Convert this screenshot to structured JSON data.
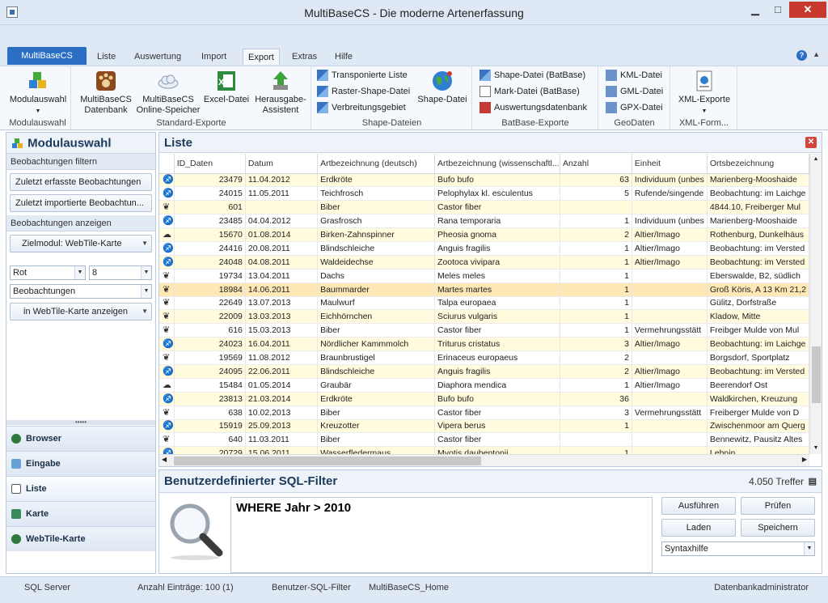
{
  "window": {
    "title": "MultiBaseCS - Die moderne Artenerfassung",
    "minimize": "▁",
    "maximize": "□",
    "close": "✕"
  },
  "ribbon": {
    "app_tab": "MultiBaseCS",
    "tabs": [
      "Liste",
      "Auswertung",
      "Import",
      "Export",
      "Extras",
      "Hilfe"
    ],
    "active_tab": "Export",
    "groups": {
      "modulauswahl": {
        "label": "Modulauswahl",
        "button": "Modulauswahl"
      },
      "standard": {
        "label": "Standard-Exporte",
        "b1a": "MultiBaseCS",
        "b1b": "Datenbank",
        "b2a": "MultiBaseCS",
        "b2b": "Online-Speicher",
        "b3": "Excel-Datei",
        "b4a": "Herausgabe-",
        "b4b": "Assistent"
      },
      "shape": {
        "label": "Shape-Dateien",
        "s1": "Transponierte Liste",
        "s2": "Raster-Shape-Datei",
        "s3": "Verbreitungsgebiet",
        "big": "Shape-Datei"
      },
      "batbase": {
        "label": "BatBase-Exporte",
        "s1": "Shape-Datei (BatBase)",
        "s2": "Mark-Datei (BatBase)",
        "s3": "Auswertungsdatenbank"
      },
      "geodaten": {
        "label": "GeoDaten",
        "s1": "KML-Datei",
        "s2": "GML-Datei",
        "s3": "GPX-Datei"
      },
      "xml": {
        "label": "XML-Form...",
        "big": "XML-Exporte"
      }
    }
  },
  "left": {
    "title": "Modulauswahl",
    "filter_section": "Beobachtungen filtern",
    "btn_recent_captured": "Zuletzt erfasste Beobachtungen",
    "btn_recent_imported": "Zuletzt  importierte Beobachtun...",
    "show_section": "Beobachtungen anzeigen",
    "target_module": "Zielmodul: WebTile-Karte",
    "color_value": "Rot",
    "size_value": "8",
    "type_value": "Beobachtungen",
    "show_in": "in WebTile-Karte anzeigen",
    "nav": [
      "Browser",
      "Eingabe",
      "Liste",
      "Karte",
      "WebTile-Karte"
    ]
  },
  "list": {
    "title": "Liste",
    "columns": [
      "ID_Daten",
      "Datum",
      "Artbezeichnung (deutsch)",
      "Artbezeichnung  (wissenschaftl...",
      "Anzahl",
      "Einheit",
      "Ortsbezeichnung"
    ],
    "rows": [
      {
        "icon": "frog",
        "id": "23479",
        "date": "11.04.2012",
        "de": "Erdkröte",
        "sci": "Bufo bufo",
        "n": "63",
        "unit": "Individuum (unbes",
        "place": "Marienberg-Mooshaide"
      },
      {
        "icon": "frog",
        "id": "24015",
        "date": "11.05.2011",
        "de": "Teichfrosch",
        "sci": "Pelophylax kl. esculentus",
        "n": "5",
        "unit": "Rufende/singende",
        "place": "Beobachtung: im Laichge"
      },
      {
        "icon": "paw",
        "id": "601",
        "date": "",
        "de": "Biber",
        "sci": "Castor fiber",
        "n": "",
        "unit": "",
        "place": "4844.10, Freiberger Mul"
      },
      {
        "icon": "frog",
        "id": "23485",
        "date": "04.04.2012",
        "de": "Grasfrosch",
        "sci": "Rana temporaria",
        "n": "1",
        "unit": "Individuum (unbes",
        "place": "Marienberg-Mooshaide"
      },
      {
        "icon": "moth",
        "id": "15670",
        "date": "01.08.2014",
        "de": "Birken-Zahnspinner",
        "sci": "Pheosia gnoma",
        "n": "2",
        "unit": "Altier/Imago",
        "place": "Rothenburg, Dunkelhäus"
      },
      {
        "icon": "frog",
        "id": "24416",
        "date": "20.08.2011",
        "de": "Blindschleiche",
        "sci": "Anguis fragilis",
        "n": "1",
        "unit": "Altier/Imago",
        "place": "Beobachtung: im Versted"
      },
      {
        "icon": "frog",
        "id": "24048",
        "date": "04.08.2011",
        "de": "Waldeidechse",
        "sci": "Zootoca vivipara",
        "n": "1",
        "unit": "Altier/Imago",
        "place": "Beobachtung: im Versted"
      },
      {
        "icon": "paw",
        "id": "19734",
        "date": "13.04.2011",
        "de": "Dachs",
        "sci": "Meles meles",
        "n": "1",
        "unit": "",
        "place": "Eberswalde, B2, südlich"
      },
      {
        "icon": "paw",
        "id": "18984",
        "date": "14.06.2011",
        "de": "Baummarder",
        "sci": "Martes martes",
        "n": "1",
        "unit": "",
        "place": "Groß Köris, A 13 Km 21,2"
      },
      {
        "icon": "paw",
        "id": "22649",
        "date": "13.07.2013",
        "de": "Maulwurf",
        "sci": "Talpa europaea",
        "n": "1",
        "unit": "",
        "place": "Gülitz, Dorfstraße"
      },
      {
        "icon": "paw",
        "id": "22009",
        "date": "13.03.2013",
        "de": "Eichhörnchen",
        "sci": "Sciurus vulgaris",
        "n": "1",
        "unit": "",
        "place": "Kladow, Mitte"
      },
      {
        "icon": "paw",
        "id": "616",
        "date": "15.03.2013",
        "de": "Biber",
        "sci": "Castor fiber",
        "n": "1",
        "unit": "Vermehrungsstätt",
        "place": "Freibger Mulde von Mul"
      },
      {
        "icon": "frog",
        "id": "24023",
        "date": "16.04.2011",
        "de": "Nördlicher Kammmolch",
        "sci": "Triturus cristatus",
        "n": "3",
        "unit": "Altier/Imago",
        "place": "Beobachtung: im Laichge"
      },
      {
        "icon": "paw",
        "id": "19569",
        "date": "11.08.2012",
        "de": "Braunbrustigel",
        "sci": "Erinaceus europaeus",
        "n": "2",
        "unit": "",
        "place": "Borgsdorf, Sportplatz"
      },
      {
        "icon": "frog",
        "id": "24095",
        "date": "22.06.2011",
        "de": "Blindschleiche",
        "sci": "Anguis fragilis",
        "n": "2",
        "unit": "Altier/Imago",
        "place": "Beobachtung: im Versted"
      },
      {
        "icon": "moth",
        "id": "15484",
        "date": "01.05.2014",
        "de": "Graubär",
        "sci": "Diaphora mendica",
        "n": "1",
        "unit": "Altier/Imago",
        "place": "Beerendorf Ost"
      },
      {
        "icon": "frog",
        "id": "23813",
        "date": "21.03.2014",
        "de": "Erdkröte",
        "sci": "Bufo bufo",
        "n": "36",
        "unit": "",
        "place": "Waldkirchen, Kreuzung"
      },
      {
        "icon": "paw",
        "id": "638",
        "date": "10.02.2013",
        "de": "Biber",
        "sci": "Castor fiber",
        "n": "3",
        "unit": "Vermehrungsstätt",
        "place": "Freiberger Mulde von D"
      },
      {
        "icon": "frog",
        "id": "15919",
        "date": "25.09.2013",
        "de": "Kreuzotter",
        "sci": "Vipera berus",
        "n": "1",
        "unit": "",
        "place": "Zwischenmoor am Querg"
      },
      {
        "icon": "paw",
        "id": "640",
        "date": "11.03.2011",
        "de": "Biber",
        "sci": "Castor fiber",
        "n": "",
        "unit": "",
        "place": "Bennewitz, Pausitz Altes"
      },
      {
        "icon": "bat",
        "id": "20729",
        "date": "15.06.2011",
        "de": "Wasserfledermaus",
        "sci": "Myotis daubentonii",
        "n": "1",
        "unit": "",
        "place": "Lebnin"
      }
    ]
  },
  "sql": {
    "title": "Benutzerdefinierter SQL-Filter",
    "hits": "4.050 Treffer",
    "query": "WHERE Jahr > 2010",
    "btn_run": "Ausführen",
    "btn_check": "Prüfen",
    "btn_load": "Laden",
    "btn_save": "Speichern",
    "syntax": "Syntaxhilfe"
  },
  "status": {
    "server": "SQL Server",
    "entries": "Anzahl Einträge: 100 (1)",
    "filter": "Benutzer-SQL-Filter",
    "db": "MultiBaseCS_Home",
    "user": "Datenbankadministrator"
  }
}
